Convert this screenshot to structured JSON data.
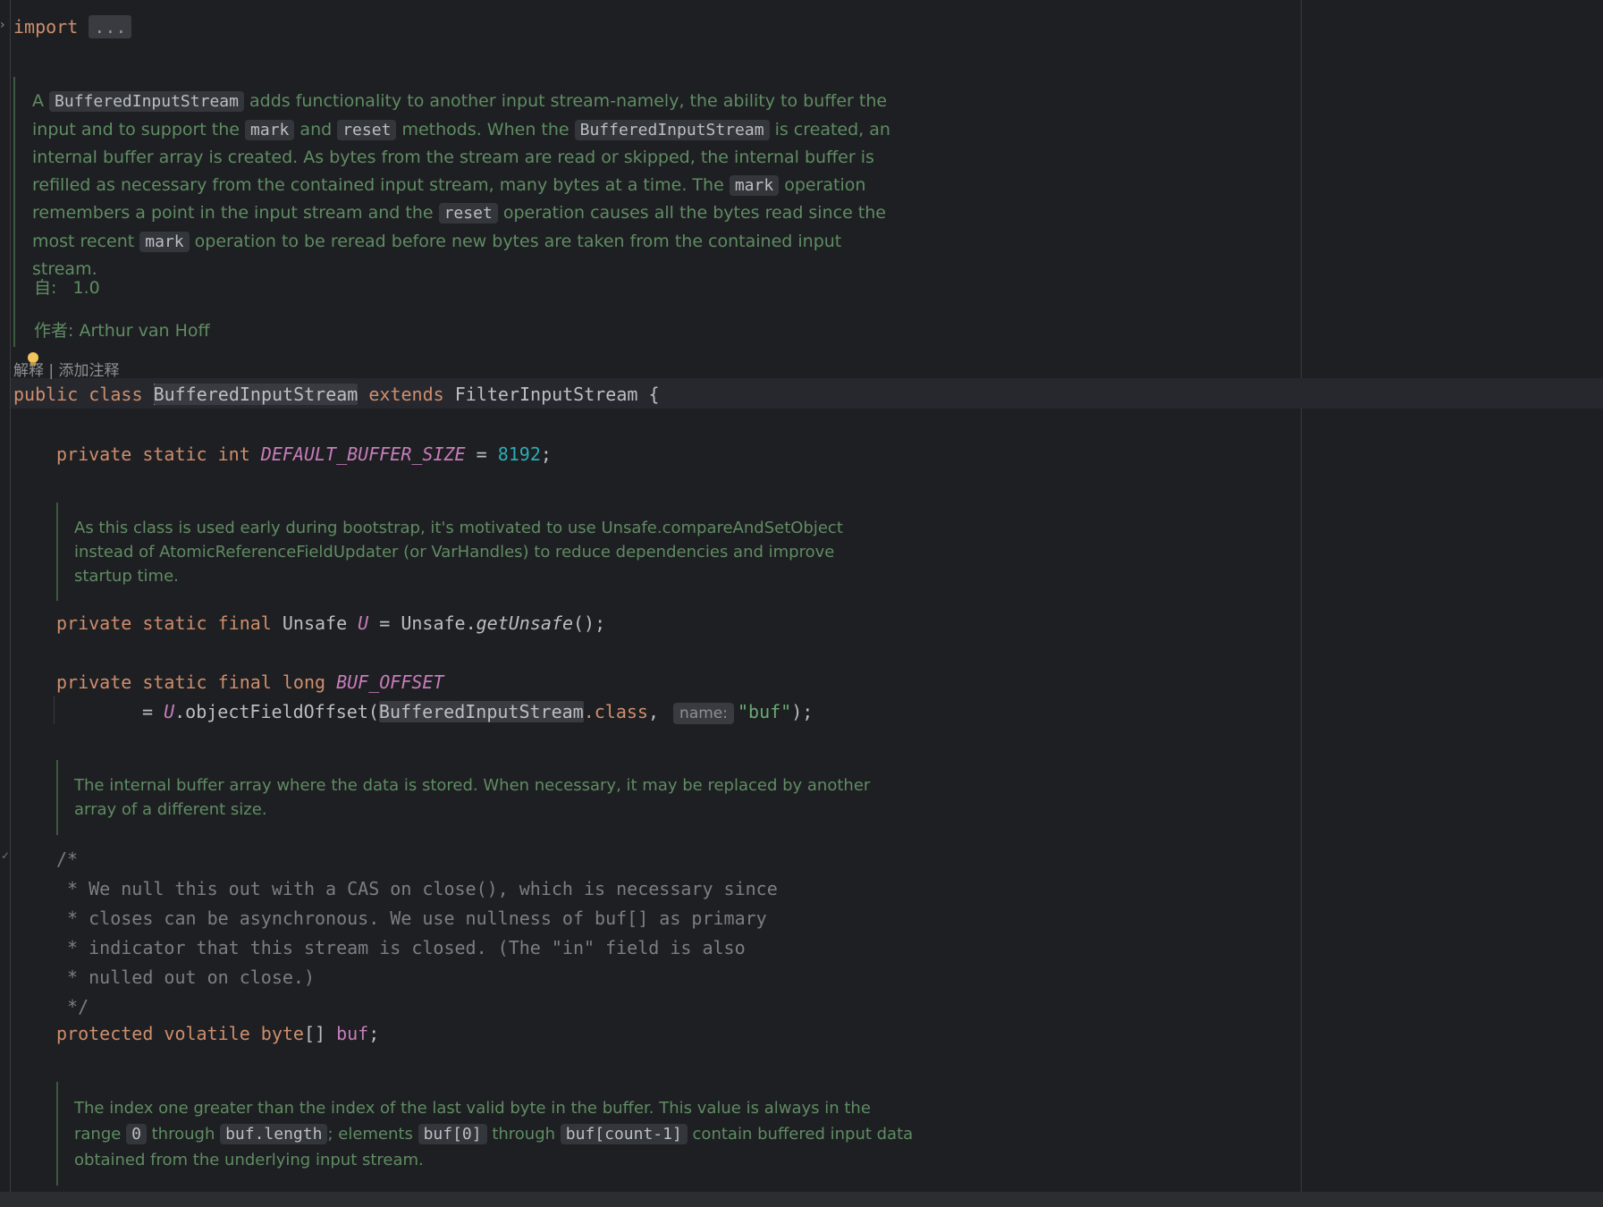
{
  "code": {
    "import_kw": "import",
    "import_fold": "...",
    "class_line": {
      "public": "public",
      "class": "class",
      "name": "BufferedInputStream",
      "extends": "extends",
      "parent": "FilterInputStream",
      "brace": " {"
    },
    "buffer_size": {
      "mods": "private static int",
      "name": "DEFAULT_BUFFER_SIZE",
      "eq": " = ",
      "value": "8192",
      "end": ";"
    },
    "unsafe_line": {
      "mods": "private static final",
      "type": "Unsafe",
      "name": "U",
      "eq": " = Unsafe.",
      "call": "getUnsafe",
      "end": "();"
    },
    "offset_line": {
      "mods": "private static final long",
      "name": "BUF_OFFSET",
      "cont_eq": "= ",
      "u": "U",
      "call": ".objectFieldOffset(",
      "cls": "BufferedInputStream",
      "dot_class": ".class",
      "comma": ", ",
      "hint": "name:",
      "str": "\"buf\"",
      "end": ");"
    },
    "block_comment": [
      "/*",
      " * We null this out with a CAS on close(), which is necessary since",
      " * closes can be asynchronous. We use nullness of buf[] as primary",
      " * indicator that this stream is closed. (The \"in\" field is also",
      " * nulled out on close.)",
      " */"
    ],
    "buf_line": {
      "mods": "protected volatile byte",
      "arr": "[] ",
      "name": "buf",
      "end": ";"
    }
  },
  "docs": {
    "class_doc": {
      "t1": "A ",
      "c1": "BufferedInputStream",
      "t2": " adds functionality to another input stream-namely, the ability to buffer the input and to support the ",
      "c2": "mark",
      "t3": " and ",
      "c3": "reset",
      "t4": " methods. When the ",
      "c4": "BufferedInputStream",
      "t5": " is created, an internal buffer array is created. As bytes from the stream are read or skipped, the internal buffer is refilled as necessary from the contained input stream, many bytes at a time. The ",
      "c5": "mark",
      "t6": " operation remembers a point in the input stream and the ",
      "c6": "reset",
      "t7": " operation causes all the bytes read since the most recent ",
      "c7": "mark",
      "t8": " operation to be reread before new bytes are taken from the contained input stream."
    },
    "since_label": "自:",
    "since_value": "1.0",
    "author": "作者: Arthur van Hoff",
    "lens": "解释 | 添加注释",
    "unsafe_doc": "As this class is used early during bootstrap, it's motivated to use Unsafe.compareAndSetObject instead of AtomicReferenceFieldUpdater (or VarHandles) to reduce dependencies and improve startup time.",
    "buf_doc": "The internal buffer array where the data is stored. When necessary, it may be replaced by another array of a different size.",
    "count_doc": {
      "t1": "The index one greater than the index of the last valid byte in the buffer. This value is always in the range ",
      "c1": "0",
      "t2": " through ",
      "c2": "buf.length",
      "t3": "; elements ",
      "c3": "buf[0]",
      "t4": " through ",
      "c4": "buf[count-1]",
      "t5": " contain buffered input data obtained from the underlying input stream."
    }
  },
  "colors": {
    "background": "#1e1f22",
    "keyword": "#cf8e6d",
    "constant": "#c77dbb",
    "number": "#2aacb8",
    "string": "#6aab73",
    "doc_text": "#5f8c63",
    "comment": "#7a7e85"
  }
}
